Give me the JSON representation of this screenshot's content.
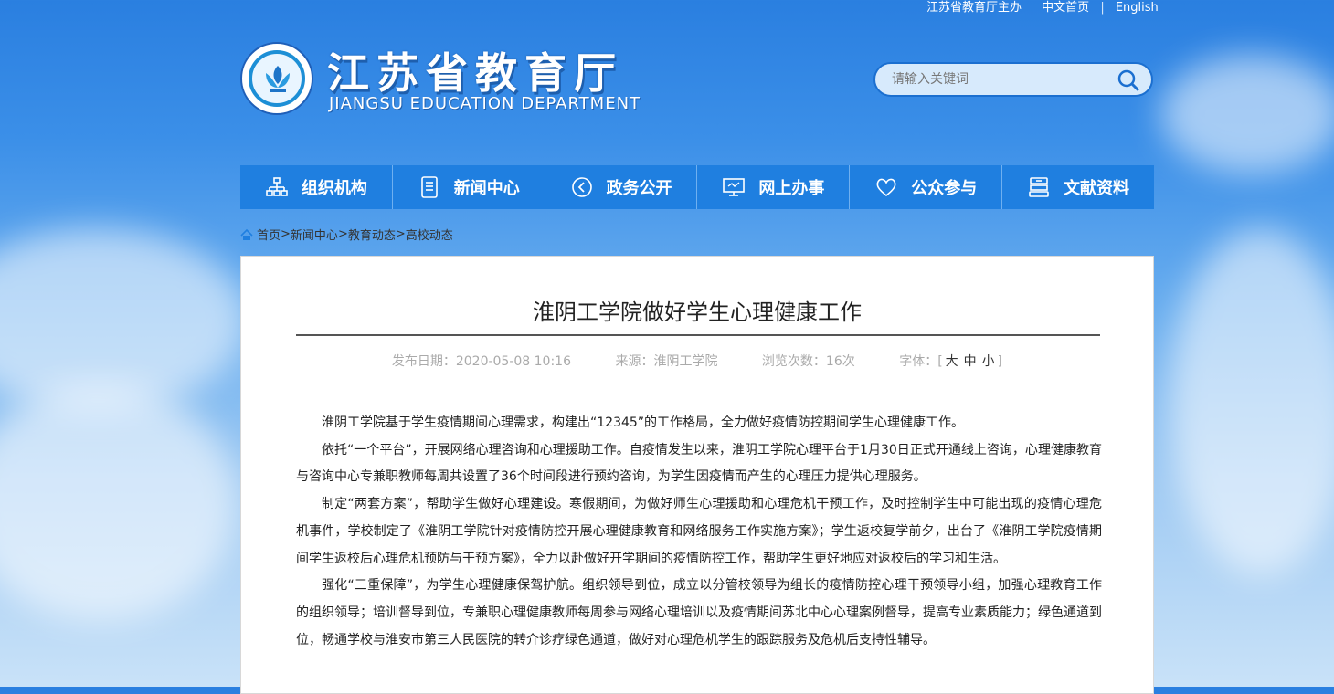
{
  "top_links": {
    "host": "江苏省教育厅主办",
    "home": "中文首页",
    "sep": "|",
    "english": "English"
  },
  "site": {
    "title": "江苏省教育厅",
    "subtitle": "JIANGSU EDUCATION DEPARTMENT"
  },
  "search": {
    "placeholder": "请输入关键词"
  },
  "nav": [
    {
      "label": "组织机构",
      "icon": "org-chart-icon"
    },
    {
      "label": "新闻中心",
      "icon": "document-icon"
    },
    {
      "label": "政务公开",
      "icon": "circle-arrow-icon"
    },
    {
      "label": "网上办事",
      "icon": "monitor-icon"
    },
    {
      "label": "公众参与",
      "icon": "heart-icon"
    },
    {
      "label": "文献资料",
      "icon": "archive-icon"
    }
  ],
  "breadcrumb": {
    "home": "首页",
    "c1": "新闻中心",
    "c2": "教育动态",
    "c3": "高校动态",
    "sep": ">"
  },
  "article": {
    "title": "淮阴工学院做好学生心理健康工作",
    "date": "发布日期：2020-05-08 10:16",
    "source": "来源：淮阴工学院",
    "views": "浏览次数：16次",
    "fontsize_label": "字体：[",
    "fontsize_large": "大",
    "fontsize_medium": "中",
    "fontsize_small": "小",
    "fontsize_close": "]",
    "paragraphs": [
      "淮阴工学院基于学生疫情期间心理需求，构建出“12345”的工作格局，全力做好疫情防控期间学生心理健康工作。",
      "依托“一个平台”，开展网络心理咨询和心理援助工作。自疫情发生以来，淮阴工学院心理平台于1月30日正式开通线上咨询，心理健康教育与咨询中心专兼职教师每周共设置了36个时间段进行预约咨询，为学生因疫情而产生的心理压力提供心理服务。",
      "制定“两套方案”，帮助学生做好心理建设。寒假期间，为做好师生心理援助和心理危机干预工作，及时控制学生中可能出现的疫情心理危机事件，学校制定了《淮阴工学院针对疫情防控开展心理健康教育和网络服务工作实施方案》；学生返校复学前夕，出台了《淮阴工学院疫情期间学生返校后心理危机预防与干预方案》，全力以赴做好开学期间的疫情防控工作，帮助学生更好地应对返校后的学习和生活。",
      "强化“三重保障”，为学生心理健康保驾护航。组织领导到位，成立以分管校领导为组长的疫情防控心理干预领导小组，加强心理教育工作的组织领导；培训督导到位，专兼职心理健康教师每周参与网络心理培训以及疫情期间苏北中心心理案例督导，提高专业素质能力；绿色通道到位，畅通学校与淮安市第三人民医院的转介诊疗绿色通道，做好对心理危机学生的跟踪服务及危机后支持性辅导。"
    ]
  },
  "colors": {
    "nav_bg": "#1f7fe0",
    "title_shadow": "#1e5fae",
    "search_border": "#1b6fd0"
  }
}
